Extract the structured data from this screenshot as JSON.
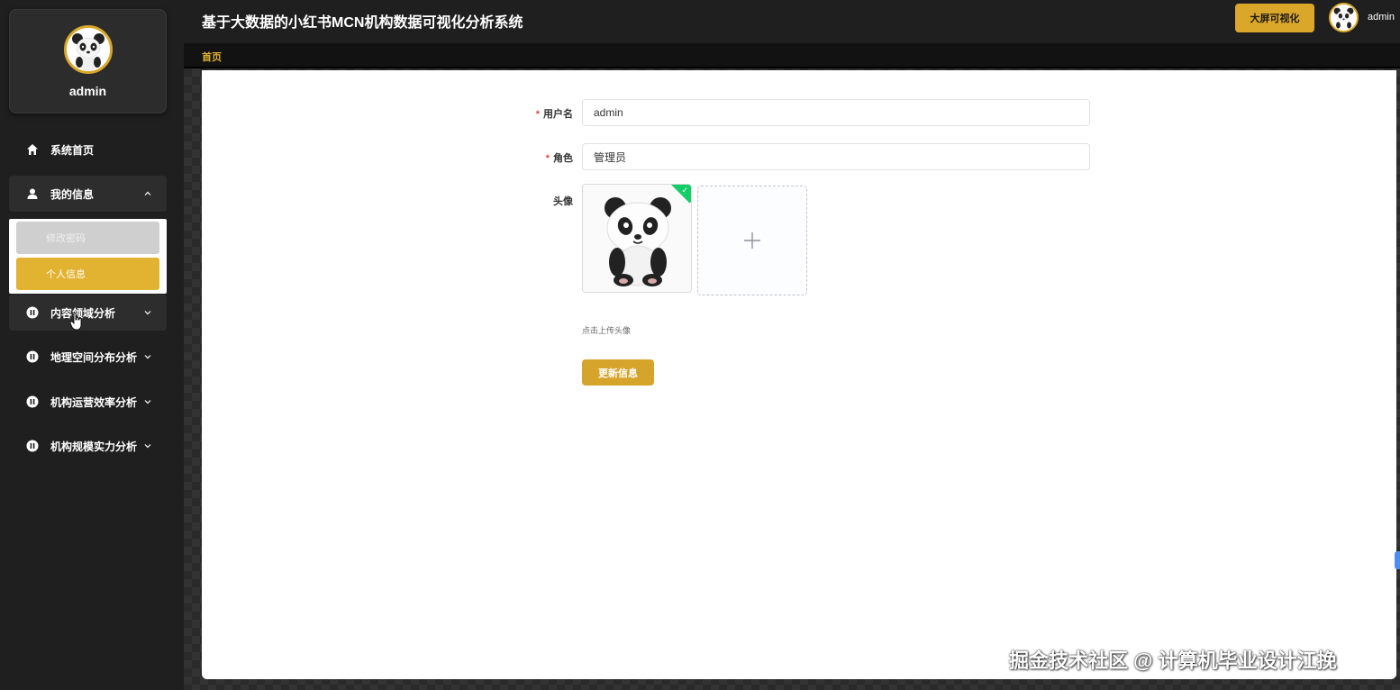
{
  "header": {
    "title": "基于大数据的小红书MCN机构数据可视化分析系统",
    "screen_button": "大屏可视化",
    "username": "admin"
  },
  "profile": {
    "name": "admin"
  },
  "sidebar": {
    "items": [
      {
        "label": "系统首页",
        "icon": "home-icon"
      },
      {
        "label": "我的信息",
        "icon": "user-icon"
      },
      {
        "label": "内容领域分析",
        "icon": "pause-circle-icon"
      },
      {
        "label": "地理空间分布分析",
        "icon": "pause-circle-icon"
      },
      {
        "label": "机构运营效率分析",
        "icon": "pause-circle-icon"
      },
      {
        "label": "机构规模实力分析",
        "icon": "pause-circle-icon"
      }
    ],
    "submenu": [
      {
        "label": "修改密码"
      },
      {
        "label": "个人信息"
      }
    ]
  },
  "tabs": {
    "home": "首页"
  },
  "form": {
    "username_label": "用户名",
    "username_value": "admin",
    "role_label": "角色",
    "role_value": "管理员",
    "avatar_label": "头像",
    "upload_hint": "点击上传头像",
    "update_button": "更新信息",
    "required_mark": "*"
  },
  "watermark": "掘金技术社区 @ 计算机毕业设计江挽",
  "colors": {
    "accent": "#dba72b",
    "active_submenu": "#e2b331",
    "success": "#13ce66"
  }
}
